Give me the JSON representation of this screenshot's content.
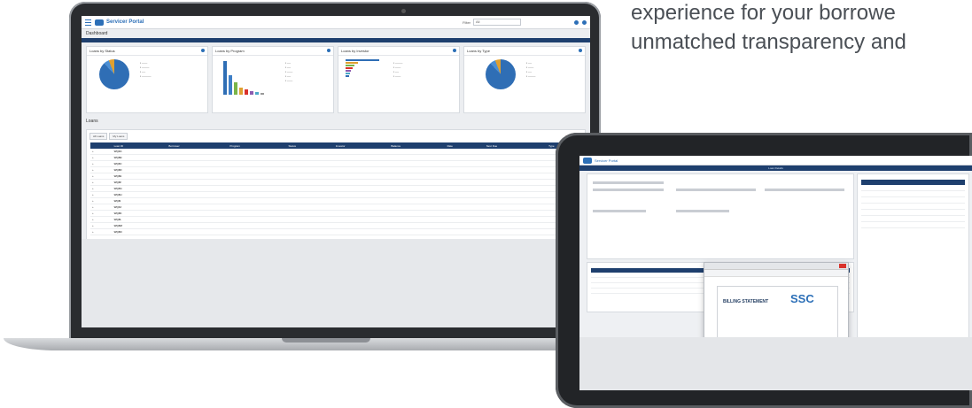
{
  "headline": {
    "line1": "experience for your borrowe",
    "line2": "unmatched transparency and"
  },
  "laptop": {
    "app_title": "Servicer Portal",
    "filter_label": "Filter",
    "filter_value": "All",
    "section_title": "Dashboard",
    "widgets": [
      {
        "title": "Loans by Status"
      },
      {
        "title": "Loans by Program"
      },
      {
        "title": "Loans by Investor"
      },
      {
        "title": "Loans by Type"
      }
    ],
    "panel_title": "Loans",
    "tabs": [
      "All Loans",
      "My Loans"
    ],
    "table": {
      "columns": [
        "",
        "Loan ID",
        "Borrower",
        "Program",
        "Status",
        "Investor",
        "Balance",
        "Rate",
        "Next Due",
        "Type"
      ],
      "rows": [
        [
          "+",
          "WQ8A",
          "",
          "",
          "",
          "",
          "",
          "",
          "",
          ""
        ],
        [
          "+",
          "WQ8B",
          "",
          "",
          "",
          "",
          "",
          "",
          "",
          ""
        ],
        [
          "+",
          "WQ8C",
          "",
          "",
          "",
          "",
          "",
          "",
          "",
          ""
        ],
        [
          "+",
          "WQ8D",
          "",
          "",
          "",
          "",
          "",
          "",
          "",
          ""
        ],
        [
          "+",
          "WQ8E",
          "",
          "",
          "",
          "",
          "",
          "",
          "",
          ""
        ],
        [
          "+",
          "WQ8F",
          "",
          "",
          "",
          "",
          "",
          "",
          "",
          ""
        ],
        [
          "+",
          "WQ8G",
          "",
          "",
          "",
          "",
          "",
          "",
          "",
          ""
        ],
        [
          "+",
          "WQ8H",
          "",
          "",
          "",
          "",
          "",
          "",
          "",
          ""
        ],
        [
          "+",
          "WQ8I",
          "",
          "",
          "",
          "",
          "",
          "",
          "",
          ""
        ],
        [
          "+",
          "WQ8J",
          "",
          "",
          "",
          "",
          "",
          "",
          "",
          ""
        ],
        [
          "+",
          "WQ8K",
          "",
          "",
          "",
          "",
          "",
          "",
          "",
          ""
        ],
        [
          "+",
          "WQ8L",
          "",
          "",
          "",
          "",
          "",
          "",
          "",
          ""
        ],
        [
          "+",
          "WQ8M",
          "",
          "",
          "",
          "",
          "",
          "",
          "",
          ""
        ],
        [
          "+",
          "WQ8N",
          "",
          "",
          "",
          "",
          "",
          "",
          "",
          ""
        ]
      ]
    }
  },
  "tablet": {
    "app_title": "Servicer Portal",
    "band_text": "Loan Details",
    "statement": {
      "title": "BILLING STATEMENT",
      "logo": "SSC"
    }
  },
  "colors": {
    "navy": "#1e3f6e",
    "blue": "#2c6fb7",
    "green": "#2f8a3a",
    "red": "#d9322b",
    "amber": "#e0a030"
  }
}
